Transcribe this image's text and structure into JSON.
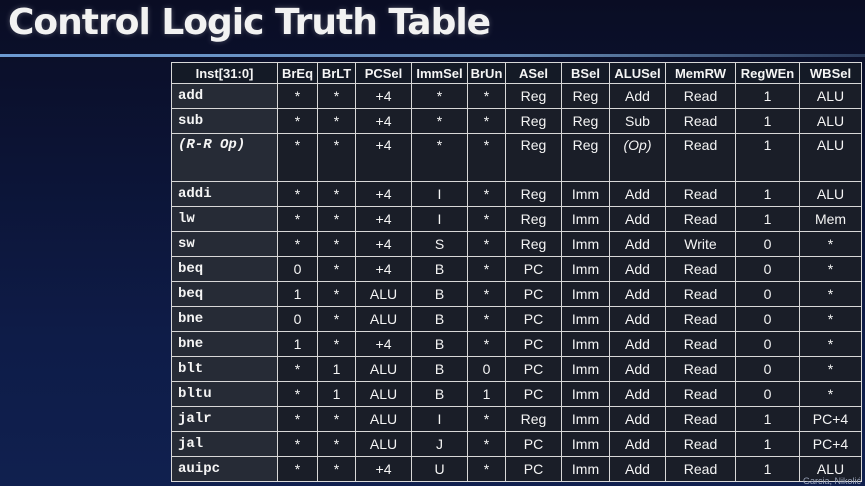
{
  "title": "Control Logic Truth Table",
  "columns": [
    "Inst[31:0]",
    "BrEq",
    "BrLT",
    "PCSel",
    "ImmSel",
    "BrUn",
    "ASel",
    "BSel",
    "ALUSel",
    "MemRW",
    "RegWEn",
    "WBSel"
  ],
  "rows": [
    [
      "add",
      "*",
      "*",
      "+4",
      "*",
      "*",
      "Reg",
      "Reg",
      "Add",
      "Read",
      "1",
      "ALU"
    ],
    [
      "sub",
      "*",
      "*",
      "+4",
      "*",
      "*",
      "Reg",
      "Reg",
      "Sub",
      "Read",
      "1",
      "ALU"
    ],
    [
      "(R-R Op)",
      "*",
      "*",
      "+4",
      "*",
      "*",
      "Reg",
      "Reg",
      "(Op)",
      "Read",
      "1",
      "ALU"
    ],
    [
      "addi",
      "*",
      "*",
      "+4",
      "I",
      "*",
      "Reg",
      "Imm",
      "Add",
      "Read",
      "1",
      "ALU"
    ],
    [
      "lw",
      "*",
      "*",
      "+4",
      "I",
      "*",
      "Reg",
      "Imm",
      "Add",
      "Read",
      "1",
      "Mem"
    ],
    [
      "sw",
      "*",
      "*",
      "+4",
      "S",
      "*",
      "Reg",
      "Imm",
      "Add",
      "Write",
      "0",
      "*"
    ],
    [
      "beq",
      "0",
      "*",
      "+4",
      "B",
      "*",
      "PC",
      "Imm",
      "Add",
      "Read",
      "0",
      "*"
    ],
    [
      "beq",
      "1",
      "*",
      "ALU",
      "B",
      "*",
      "PC",
      "Imm",
      "Add",
      "Read",
      "0",
      "*"
    ],
    [
      "bne",
      "0",
      "*",
      "ALU",
      "B",
      "*",
      "PC",
      "Imm",
      "Add",
      "Read",
      "0",
      "*"
    ],
    [
      "bne",
      "1",
      "*",
      "+4",
      "B",
      "*",
      "PC",
      "Imm",
      "Add",
      "Read",
      "0",
      "*"
    ],
    [
      "blt",
      "*",
      "1",
      "ALU",
      "B",
      "0",
      "PC",
      "Imm",
      "Add",
      "Read",
      "0",
      "*"
    ],
    [
      "bltu",
      "*",
      "1",
      "ALU",
      "B",
      "1",
      "PC",
      "Imm",
      "Add",
      "Read",
      "0",
      "*"
    ],
    [
      "jalr",
      "*",
      "*",
      "ALU",
      "I",
      "*",
      "Reg",
      "Imm",
      "Add",
      "Read",
      "1",
      "PC+4"
    ],
    [
      "jal",
      "*",
      "*",
      "ALU",
      "J",
      "*",
      "PC",
      "Imm",
      "Add",
      "Read",
      "1",
      "PC+4"
    ],
    [
      "auipc",
      "*",
      "*",
      "+4",
      "U",
      "*",
      "PC",
      "Imm",
      "Add",
      "Read",
      "1",
      "ALU"
    ]
  ],
  "credit": "Garcia, Nikolić"
}
